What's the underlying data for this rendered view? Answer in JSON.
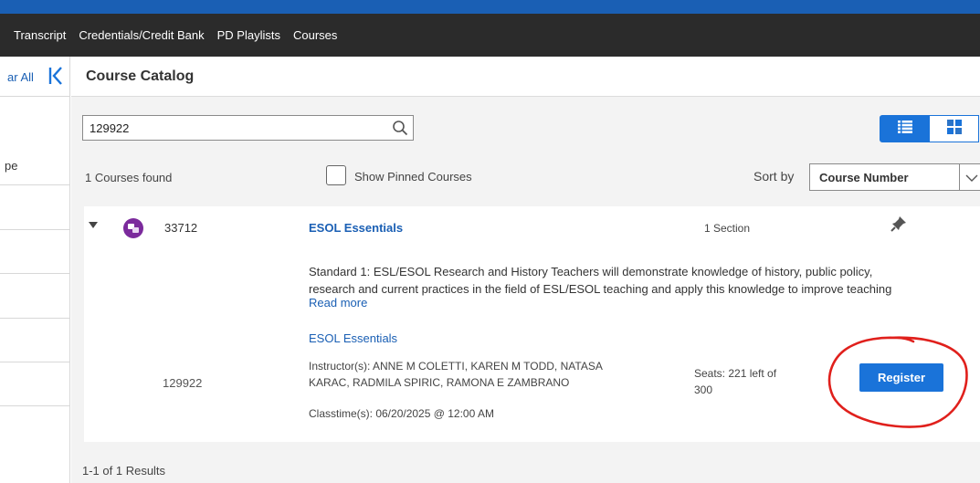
{
  "colors": {
    "accent": "#1a73d9",
    "link": "#1a5fb4",
    "nav_background": "#2b2b2b",
    "course_icon": "#7b2a9c",
    "annotation": "#e0201c"
  },
  "nav": {
    "items": [
      "Transcript",
      "Credentials/Credit Bank",
      "PD Playlists",
      "Courses"
    ]
  },
  "sidebar": {
    "clear_all": "ar All",
    "collapse_icon": "collapse-left-icon",
    "type_label": "pe"
  },
  "page": {
    "title": "Course Catalog"
  },
  "search": {
    "value": "129922",
    "icon": "search-icon"
  },
  "view_toggle": {
    "selected": "list",
    "icons": [
      "list-view-icon",
      "grid-view-icon"
    ]
  },
  "results": {
    "count_label": "1 Courses found",
    "pinned_label": "Show Pinned Courses",
    "pinned_checked": false,
    "sort_label": "Sort by",
    "sort_value": "Course Number",
    "pager": "1-1 of 1 Results"
  },
  "course": {
    "number": "33712",
    "title": "ESOL Essentials",
    "sections": "1 Section",
    "description": "Standard 1: ESL/ESOL Research and History Teachers will demonstrate knowledge of history, public policy, research and current practices in the field of ESL/ESOL teaching and apply this knowledge to improve teaching",
    "read_more": "Read more",
    "section": {
      "title": "ESOL Essentials",
      "number": "129922",
      "instructors": "Instructor(s): ANNE M COLETTI, KAREN M TODD, NATASA KARAC, RADMILA SPIRIC, RAMONA E ZAMBRANO",
      "seats": "Seats: 221 left of 300",
      "register": "Register",
      "classtime": "Classtime(s): 06/20/2025 @ 12:00 AM"
    }
  }
}
